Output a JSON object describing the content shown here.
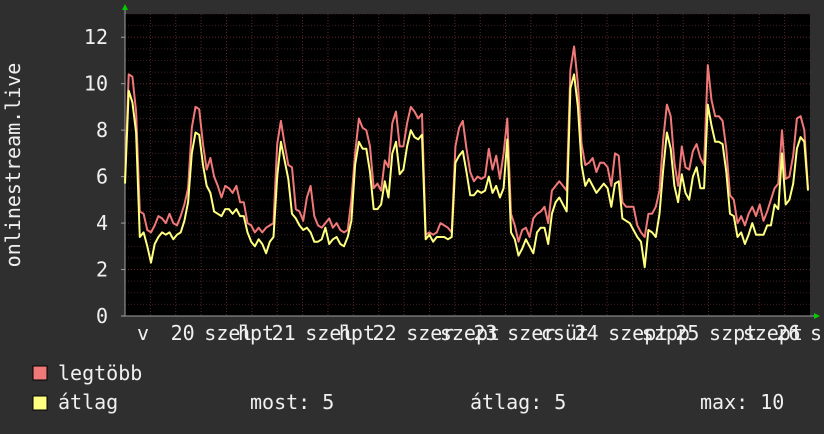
{
  "colors": {
    "background": "#2f2f2f",
    "plot_background": "#000000",
    "grid_major": "#5a2828",
    "grid_minor": "#3a2020",
    "axis": "#a0a0a0",
    "text": "#f0f0f0",
    "arrow": "#00cc00",
    "series_max": "#f07878",
    "series_avg": "#ffff80"
  },
  "chart_data": {
    "type": "line",
    "title": "",
    "ylabel": "onlinestream.live",
    "xlabel": "",
    "ylim": [
      0,
      13
    ],
    "yticks": [
      0,
      2,
      4,
      6,
      8,
      10,
      12
    ],
    "grid": true,
    "legend_placement": "bottom-left",
    "xtick_labels": [
      "v",
      "20",
      "szel",
      "hpt",
      "21",
      "szel",
      "hpt",
      "22",
      "szer",
      "szept",
      "23",
      "szer",
      "csüt",
      "24",
      "szept",
      "szpp",
      "25",
      "szpt",
      "szept",
      "26",
      "sz"
    ],
    "series": [
      {
        "name": "legtöbb",
        "color_key": "series_max",
        "values": [
          5.8,
          10.4,
          10.3,
          8.8,
          4.5,
          4.4,
          3.7,
          3.6,
          3.9,
          4.3,
          4.2,
          4.0,
          4.4,
          4.0,
          3.9,
          4.3,
          4.8,
          5.5,
          8.1,
          9.0,
          8.9,
          7.4,
          6.3,
          6.8,
          6.0,
          5.6,
          5.1,
          5.6,
          5.5,
          5.3,
          5.6,
          4.9,
          4.9,
          4.0,
          3.9,
          3.6,
          3.8,
          3.6,
          3.8,
          3.9,
          4.0,
          7.4,
          8.4,
          7.4,
          6.5,
          6.4,
          4.6,
          4.5,
          4.1,
          5.1,
          5.6,
          4.3,
          3.9,
          3.8,
          4.0,
          4.2,
          3.8,
          4.0,
          3.7,
          3.6,
          3.7,
          5.0,
          7.0,
          8.5,
          8.1,
          8.0,
          7.3,
          5.5,
          5.7,
          5.4,
          6.7,
          6.4,
          8.3,
          8.8,
          7.3,
          7.3,
          8.3,
          9.0,
          8.8,
          8.5,
          8.7,
          3.5,
          3.6,
          3.5,
          3.6,
          4.0,
          3.9,
          3.8,
          3.6,
          7.3,
          8.1,
          8.4,
          7.2,
          6.2,
          5.8,
          6.0,
          5.9,
          6.0,
          7.2,
          6.3,
          6.9,
          5.9,
          7.0,
          8.5,
          4.4,
          3.9,
          3.2,
          3.7,
          3.8,
          3.4,
          4.2,
          4.4,
          4.5,
          4.7,
          4.0,
          5.4,
          5.6,
          5.8,
          5.6,
          5.4,
          10.6,
          11.6,
          10.0,
          7.4,
          6.5,
          6.6,
          6.8,
          6.2,
          6.6,
          6.6,
          6.4,
          5.6,
          7.0,
          6.9,
          4.9,
          4.7,
          4.7,
          4.7,
          3.9,
          3.6,
          3.4,
          4.4,
          4.4,
          4.7,
          5.4,
          7.6,
          9.1,
          8.6,
          6.6,
          5.6,
          7.3,
          6.4,
          6.3,
          7.1,
          7.4,
          6.8,
          6.5,
          10.8,
          9.3,
          8.6,
          8.6,
          8.4,
          7.2,
          5.2,
          5.0,
          4.0,
          4.3,
          3.9,
          4.4,
          4.7,
          4.3,
          4.8,
          4.1,
          4.5,
          5.0,
          5.5,
          5.7,
          8.0,
          5.9,
          6.0,
          6.9,
          8.5,
          8.6,
          8.0,
          5.5
        ],
        "dots": []
      },
      {
        "name": "átlag",
        "color_key": "series_avg",
        "values": [
          5.7,
          9.7,
          9.2,
          7.9,
          3.4,
          3.6,
          3.0,
          2.3,
          3.1,
          3.4,
          3.6,
          3.5,
          3.6,
          3.3,
          3.5,
          3.6,
          4.1,
          4.9,
          7.0,
          7.9,
          7.8,
          6.5,
          5.6,
          5.3,
          4.5,
          4.4,
          4.3,
          4.6,
          4.6,
          4.4,
          4.6,
          4.3,
          4.3,
          3.6,
          3.2,
          3.0,
          3.3,
          3.1,
          2.7,
          3.2,
          3.4,
          6.0,
          7.5,
          6.7,
          5.9,
          4.4,
          4.2,
          3.9,
          3.7,
          3.8,
          3.6,
          3.2,
          3.2,
          3.3,
          3.8,
          3.1,
          3.3,
          3.4,
          3.1,
          3.0,
          3.4,
          4.1,
          6.5,
          7.5,
          7.2,
          7.2,
          6.2,
          4.6,
          4.6,
          4.8,
          5.8,
          5.1,
          7.0,
          7.5,
          6.1,
          6.3,
          7.3,
          8.0,
          7.7,
          7.6,
          7.8,
          3.3,
          3.5,
          3.2,
          3.4,
          3.4,
          3.4,
          3.3,
          3.4,
          6.6,
          6.9,
          7.1,
          6.2,
          5.2,
          5.2,
          5.4,
          5.3,
          5.4,
          6.0,
          5.3,
          5.6,
          5.1,
          5.5,
          7.6,
          3.6,
          3.3,
          2.6,
          2.9,
          3.3,
          3.0,
          2.7,
          3.6,
          3.8,
          3.8,
          3.1,
          4.4,
          4.9,
          5.1,
          4.8,
          4.5,
          9.8,
          10.4,
          9.0,
          6.5,
          5.6,
          5.9,
          5.6,
          5.3,
          5.5,
          5.7,
          5.5,
          4.7,
          5.7,
          5.8,
          4.2,
          4.1,
          4.0,
          3.7,
          3.4,
          3.2,
          2.1,
          3.7,
          3.6,
          3.4,
          4.4,
          6.3,
          7.9,
          7.2,
          5.6,
          4.9,
          6.1,
          5.3,
          5.0,
          6.0,
          6.4,
          5.5,
          5.5,
          9.1,
          8.2,
          7.5,
          7.5,
          7.4,
          6.2,
          4.4,
          4.3,
          3.4,
          3.6,
          3.1,
          3.5,
          4.0,
          3.5,
          3.5,
          3.5,
          3.9,
          3.9,
          4.8,
          4.6,
          7.0,
          4.8,
          5.0,
          5.7,
          7.2,
          7.7,
          7.5,
          5.4
        ],
        "dots": []
      }
    ]
  },
  "legend": {
    "items": [
      {
        "label": "legtöbb",
        "color_key": "series_max"
      },
      {
        "label": "átlag",
        "color_key": "series_avg"
      }
    ]
  },
  "stats": {
    "current": "most: 5",
    "average": "átlag: 5",
    "maximum": "max: 10"
  }
}
